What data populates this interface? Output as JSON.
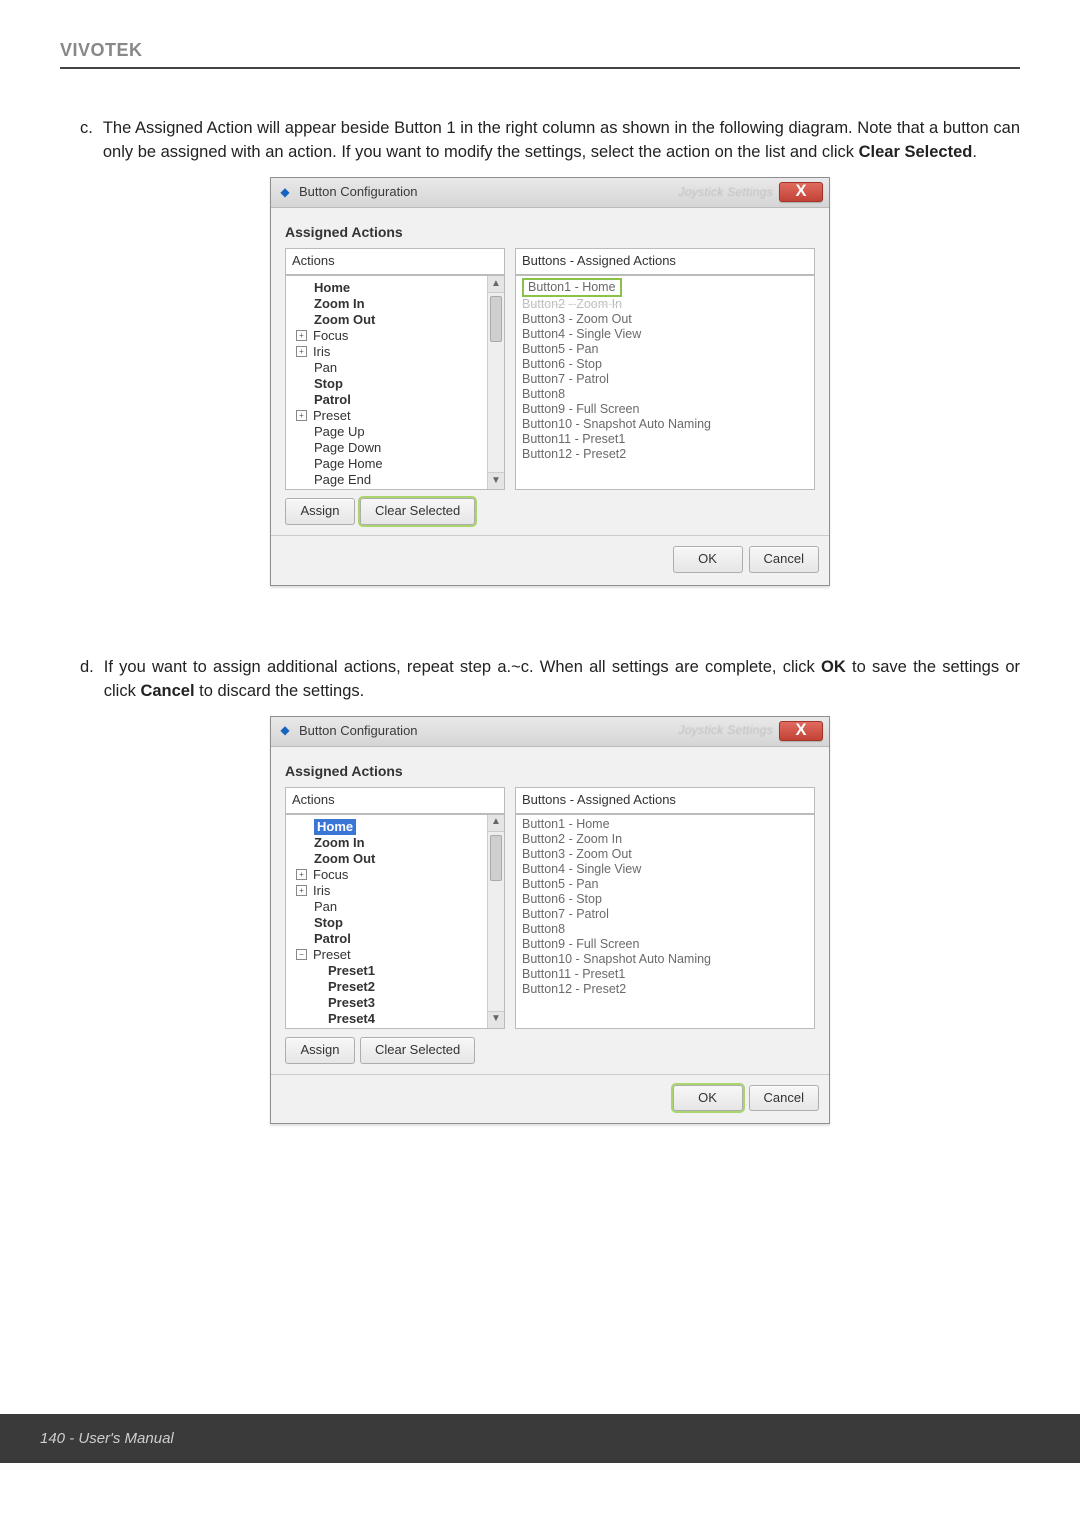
{
  "header": {
    "brand": "VIVOTEK"
  },
  "para_c": {
    "marker": "c.",
    "text_before": "The Assigned Action will appear beside Button 1 in the right column as shown in the following diagram. Note that a button can only be assigned with an action. If you want to modify the settings, select the action on the list and click ",
    "bold": "Clear Selected",
    "text_after": "."
  },
  "para_d": {
    "marker": "d.",
    "text_before": "If you want to assign additional actions, repeat step a.~c. When all settings are complete, click ",
    "bold1": "OK",
    "mid": " to save the settings or click ",
    "bold2": "Cancel",
    "text_after": " to discard the settings."
  },
  "dialog": {
    "title": "Button Configuration",
    "ghost_text": "Joystick Settings",
    "close_glyph": "X",
    "section_title": "Assigned Actions",
    "left_header": "Actions",
    "right_header": "Buttons - Assigned Actions",
    "assign_btn": "Assign",
    "clear_btn": "Clear Selected",
    "ok_btn": "OK",
    "cancel_btn": "Cancel"
  },
  "tree1": {
    "items": [
      {
        "label": "Home",
        "bold": true,
        "expander": ""
      },
      {
        "label": "Zoom In",
        "bold": true,
        "expander": ""
      },
      {
        "label": "Zoom Out",
        "bold": true,
        "expander": ""
      },
      {
        "label": "Focus",
        "bold": false,
        "expander": "+"
      },
      {
        "label": "Iris",
        "bold": false,
        "expander": "+"
      },
      {
        "label": "Pan",
        "bold": false,
        "expander": ""
      },
      {
        "label": "Stop",
        "bold": true,
        "expander": ""
      },
      {
        "label": "Patrol",
        "bold": true,
        "expander": ""
      },
      {
        "label": "Preset",
        "bold": false,
        "expander": "+"
      },
      {
        "label": "Page Up",
        "bold": false,
        "expander": ""
      },
      {
        "label": "Page Down",
        "bold": false,
        "expander": ""
      },
      {
        "label": "Page Home",
        "bold": false,
        "expander": ""
      },
      {
        "label": "Page End",
        "bold": false,
        "expander": ""
      }
    ]
  },
  "assigned1": {
    "highlight": "Button1  - Home",
    "faded": "Button2  - Zoom In",
    "rest": [
      "Button3  - Zoom Out",
      "Button4  - Single View",
      "Button5  - Pan",
      "Button6  - Stop",
      "Button7  - Patrol",
      "Button8",
      "Button9  - Full Screen",
      "Button10 - Snapshot Auto Naming",
      "Button11 - Preset1",
      "Button12 - Preset2"
    ]
  },
  "tree2": {
    "items": [
      {
        "label": "Home",
        "bold": true,
        "expander": "",
        "selected": true
      },
      {
        "label": "Zoom In",
        "bold": true,
        "expander": ""
      },
      {
        "label": "Zoom Out",
        "bold": true,
        "expander": ""
      },
      {
        "label": "Focus",
        "bold": false,
        "expander": "+"
      },
      {
        "label": "Iris",
        "bold": false,
        "expander": "+"
      },
      {
        "label": "Pan",
        "bold": false,
        "expander": ""
      },
      {
        "label": "Stop",
        "bold": true,
        "expander": ""
      },
      {
        "label": "Patrol",
        "bold": true,
        "expander": ""
      },
      {
        "label": "Preset",
        "bold": false,
        "expander": "−",
        "children": [
          "Preset1",
          "Preset2",
          "Preset3",
          "Preset4"
        ]
      }
    ]
  },
  "assigned2": [
    "Button1  - Home",
    "Button2  - Zoom In",
    "Button3  - Zoom Out",
    "Button4  - Single View",
    "Button5  - Pan",
    "Button6  - Stop",
    "Button7  - Patrol",
    "Button8",
    "Button9  - Full Screen",
    "Button10 - Snapshot Auto Naming",
    "Button11 - Preset1",
    "Button12 - Preset2"
  ],
  "footer": {
    "text": "140 - User's Manual"
  }
}
